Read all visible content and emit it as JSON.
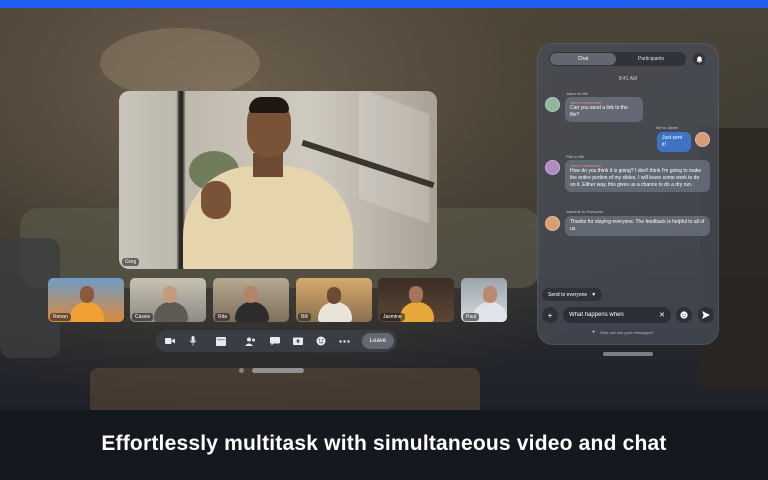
{
  "caption": "Effortlessly multitask with simultaneous video and chat",
  "main_video": {
    "name": "Greg"
  },
  "participants": [
    {
      "name": "Renan"
    },
    {
      "name": "Cassie"
    },
    {
      "name": "Rita"
    },
    {
      "name": "Bill"
    },
    {
      "name": "Jasmine"
    },
    {
      "name": "Paul"
    }
  ],
  "toolbar": {
    "icons": [
      "video-icon",
      "microphone-icon",
      "apps-icon",
      "participants-icon",
      "chat-icon",
      "share-icon",
      "reactions-icon",
      "more-icon"
    ],
    "leave_label": "Leave"
  },
  "chat": {
    "tabs": [
      "Chat",
      "Participants"
    ],
    "active_tab": "Chat",
    "time": "8:41 AM",
    "messages": [
      {
        "sender": "Jaime to Me",
        "reply": "Jaime Henderson",
        "text": "Can you send a link to the file?",
        "mine": false
      },
      {
        "sender": "Me to Jaime",
        "reply": "",
        "text": "Just sent it!",
        "mine": true
      },
      {
        "sender": "Rita to Me",
        "reply": "Jaime Henderson",
        "text": "How do you think it is going? I don't think I'm going to make the entire portion of my slides. I will leave some work to do on it. Either way, this gives us a chance to do a dry run.",
        "mine": false
      },
      {
        "sender": "Jasmine to Everyone",
        "reply": "",
        "text": "Thanks for staying everyone. The feedback is helpful to all of us.",
        "mine": false
      }
    ],
    "send_to": "Send to everyone",
    "input_value": "What happens when",
    "privacy_note": "Who can see your messages?"
  },
  "colors": {
    "accent": "#1f5ef0",
    "my_bubble": "#3f73c4",
    "reply_name": "#f08a8a"
  }
}
